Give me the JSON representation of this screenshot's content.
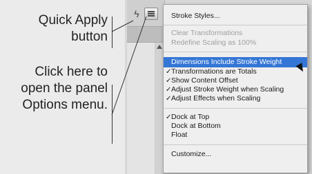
{
  "callouts": {
    "quick_apply": "Quick Apply\nbutton",
    "options_menu": "Click here to\nopen the panel\nOptions menu."
  },
  "panel": {
    "quick_apply_icon": "lightning-icon",
    "quick_apply_glyph": "ϟ",
    "options_icon": "panel-options-icon"
  },
  "menu": {
    "stroke_styles": "Stroke Styles...",
    "clear_transformations": "Clear Transformations",
    "redefine_scaling": "Redefine Scaling as 100%",
    "dimensions_include_stroke": "Dimensions Include Stroke Weight",
    "transformations_totals": "Transformations are Totals",
    "show_content_offset": "Show Content Offset",
    "adjust_stroke_weight": "Adjust Stroke Weight when Scaling",
    "adjust_effects": "Adjust Effects when Scaling",
    "dock_top": "Dock at Top",
    "dock_bottom": "Dock at Bottom",
    "float": "Float",
    "customize": "Customize...",
    "check_glyph": "✓",
    "highlight_color": "#3476d6"
  }
}
